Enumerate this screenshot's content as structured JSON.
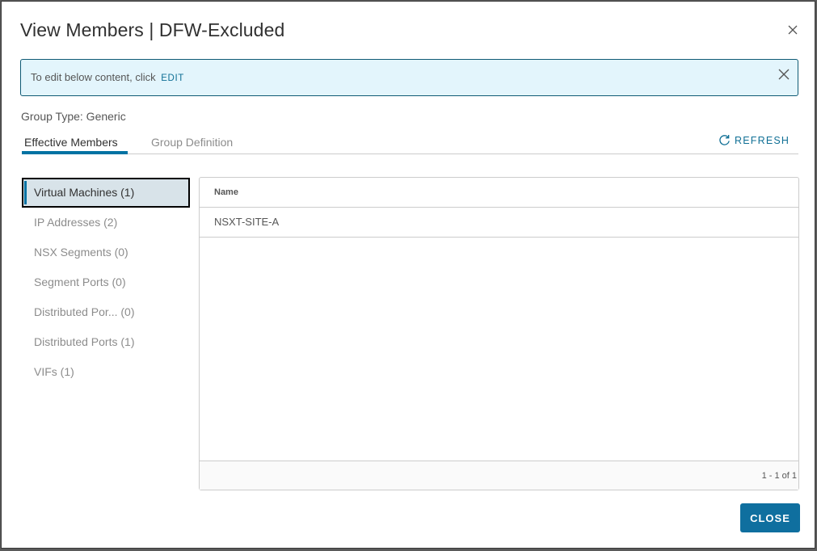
{
  "modal": {
    "title": "View Members | DFW-Excluded",
    "close_icon": "close-icon"
  },
  "alert": {
    "text": "To edit below content, click",
    "edit_link": "EDIT",
    "close_icon": "close-icon"
  },
  "group_type": "Group Type: Generic",
  "tabs": [
    {
      "label": "Effective Members",
      "active": true
    },
    {
      "label": "Group Definition",
      "active": false
    }
  ],
  "refresh": {
    "label": "REFRESH",
    "icon": "refresh-icon"
  },
  "categories": [
    {
      "label": "Virtual Machines (1)",
      "selected": true
    },
    {
      "label": "IP Addresses (2)",
      "selected": false
    },
    {
      "label": "NSX Segments (0)",
      "selected": false
    },
    {
      "label": "Segment Ports (0)",
      "selected": false
    },
    {
      "label": "Distributed Por...  (0)",
      "selected": false
    },
    {
      "label": "Distributed Ports (1)",
      "selected": false
    },
    {
      "label": "VIFs (1)",
      "selected": false
    }
  ],
  "grid": {
    "columns": [
      "Name"
    ],
    "rows": [
      [
        "NSXT-SITE-A"
      ]
    ],
    "footer": "1 - 1 of 1"
  },
  "footer": {
    "close_label": "CLOSE"
  },
  "colors": {
    "accent": "#0072a3",
    "alert_bg": "#e3f5fc",
    "button": "#0f6f9f"
  }
}
